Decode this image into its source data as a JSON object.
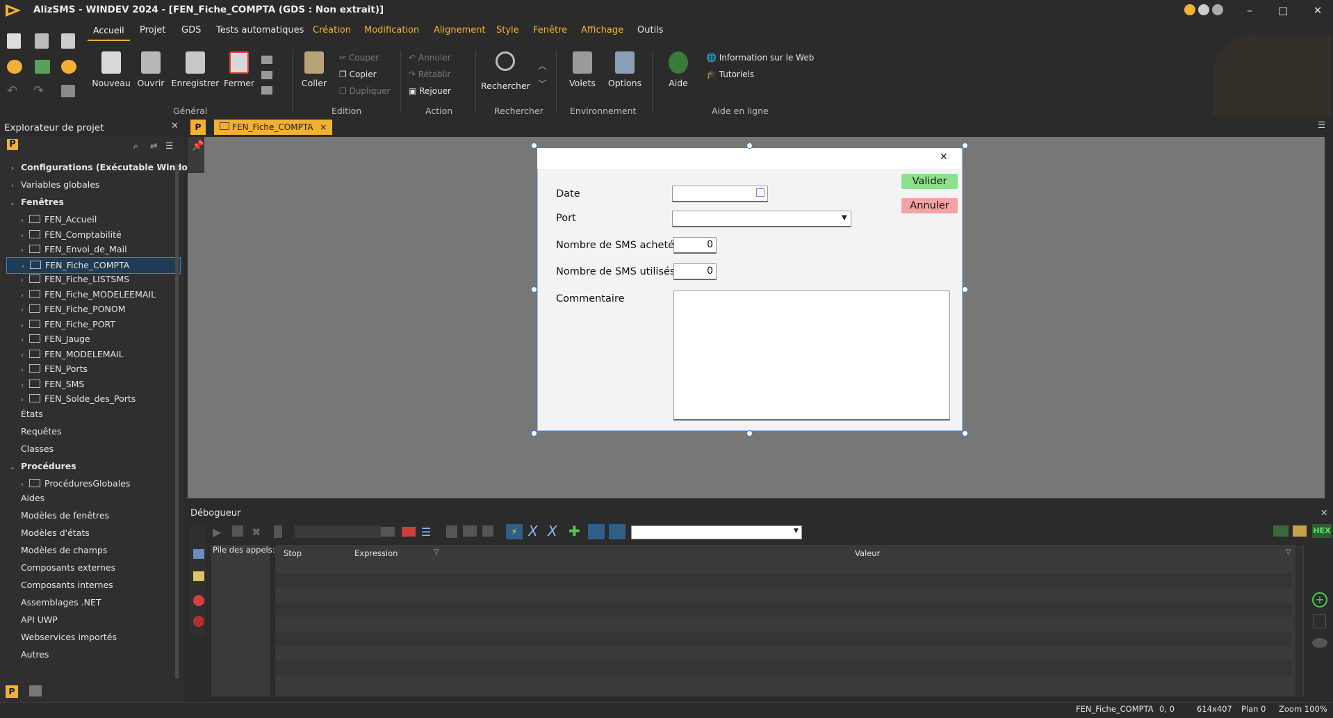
{
  "window": {
    "title": "AlizSMS - WINDEV 2024 - [FEN_Fiche_COMPTA (GDS : Non extrait)]",
    "minimize": "–",
    "maximize": "□",
    "close": "✕"
  },
  "menu_tabs": [
    "Accueil",
    "Projet",
    "GDS",
    "Tests automatiques",
    "Création",
    "Modification",
    "Alignement",
    "Style",
    "Fenêtre",
    "Affichage",
    "Outils"
  ],
  "ribbon": {
    "general": {
      "label": "Général",
      "buttons": [
        "Nouveau",
        "Ouvrir",
        "Enregistrer",
        "Fermer"
      ]
    },
    "edition": {
      "label": "Edition",
      "coller": "Coller",
      "couper": "Couper",
      "copier": "Copier",
      "dupliquer": "Dupliquer"
    },
    "action": {
      "label": "Action",
      "annuler": "Annuler",
      "retablir": "Rétablir",
      "rejouer": "Rejouer"
    },
    "rechercher": {
      "label": "Rechercher",
      "button": "Rechercher"
    },
    "environnement": {
      "label": "Environnement",
      "volets": "Volets",
      "options": "Options"
    },
    "aide": {
      "label": "Aide en ligne",
      "aide": "Aide",
      "info_web": "Information sur le Web",
      "tutoriels": "Tutoriels"
    }
  },
  "explorer": {
    "title": "Explorateur de projet",
    "items": [
      {
        "label": "Configurations (Exécutable Windo",
        "bold": true,
        "twisty": "›",
        "level": 0
      },
      {
        "label": "Variables globales",
        "bold": false,
        "twisty": "›",
        "level": 0
      },
      {
        "label": "Fenêtres",
        "bold": true,
        "twisty": "⌄",
        "level": 0
      },
      {
        "label": "FEN_Accueil",
        "level": 1
      },
      {
        "label": "FEN_Comptabilité",
        "level": 1
      },
      {
        "label": "FEN_Envoi_de_Mail",
        "level": 1
      },
      {
        "label": "FEN_Fiche_COMPTA",
        "level": 1,
        "selected": true
      },
      {
        "label": "FEN_Fiche_LISTSMS",
        "level": 1
      },
      {
        "label": "FEN_Fiche_MODELEEMAIL",
        "level": 1
      },
      {
        "label": "FEN_Fiche_PONOM",
        "level": 1
      },
      {
        "label": "FEN_Fiche_PORT",
        "level": 1
      },
      {
        "label": "FEN_Jauge",
        "level": 1
      },
      {
        "label": "FEN_MODELEMAIL",
        "level": 1
      },
      {
        "label": "FEN_Ports",
        "level": 1
      },
      {
        "label": "FEN_SMS",
        "level": 1
      },
      {
        "label": "FEN_Solde_des_Ports",
        "level": 1
      },
      {
        "label": "États",
        "level": 0
      },
      {
        "label": "Requêtes",
        "level": 0
      },
      {
        "label": "Classes",
        "level": 0
      },
      {
        "label": "Procédures",
        "bold": true,
        "twisty": "⌄",
        "level": 0
      },
      {
        "label": "ProcéduresGlobales",
        "level": 1
      },
      {
        "label": "Aides",
        "level": 0
      },
      {
        "label": "Modèles de fenêtres",
        "level": 0
      },
      {
        "label": "Modèles d'états",
        "level": 0
      },
      {
        "label": "Modèles de champs",
        "level": 0
      },
      {
        "label": "Composants externes",
        "level": 0
      },
      {
        "label": "Composants internes",
        "level": 0
      },
      {
        "label": "Assemblages .NET",
        "level": 0
      },
      {
        "label": "API UWP",
        "level": 0
      },
      {
        "label": "Webservices importés",
        "level": 0
      },
      {
        "label": "Autres",
        "level": 0
      }
    ]
  },
  "editor": {
    "tab_label": "FEN_Fiche_COMPTA",
    "tab_close": "×"
  },
  "form": {
    "close": "✕",
    "labels": {
      "date": "Date",
      "port": "Port",
      "sms_achetes": "Nombre de SMS achetés",
      "sms_utilises": "Nombre de SMS utilisés",
      "commentaire": "Commentaire"
    },
    "values": {
      "date": "",
      "port": "",
      "sms_achetes": "0",
      "sms_utilises": "0",
      "commentaire": ""
    },
    "buttons": {
      "valider": "Valider",
      "annuler": "Annuler"
    }
  },
  "debugger": {
    "title": "Débogueur",
    "call_stack": "Pile des appels:",
    "columns": [
      "Stop",
      "Expression",
      "Valeur"
    ],
    "hex": "HEX"
  },
  "status": {
    "window": "FEN_Fiche_COMPTA",
    "coords": "0, 0",
    "size": "614x407",
    "plan": "Plan 0",
    "zoom": "Zoom 100%"
  },
  "colors": {
    "accent": "#f2b134",
    "selection": "#3b82c4",
    "valider": "#8de08d",
    "annuler": "#f2a3a3"
  }
}
